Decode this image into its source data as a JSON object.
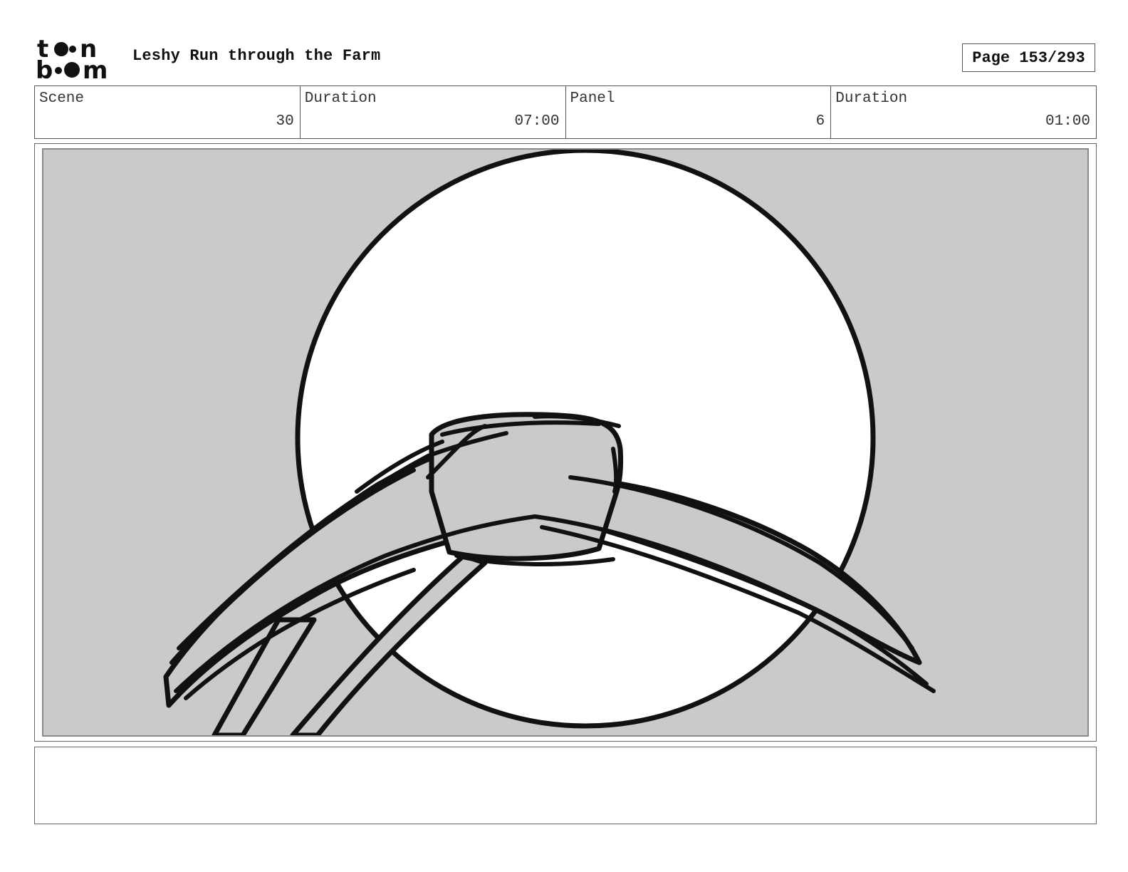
{
  "header": {
    "logo_text": "toon boom",
    "title": "Leshy Run through the Farm",
    "page_label": "Page 153/293"
  },
  "info": {
    "scene_label": "Scene",
    "scene_value": "30",
    "scene_duration_label": "Duration",
    "scene_duration_value": "07:00",
    "panel_label": "Panel",
    "panel_value": "6",
    "panel_duration_label": "Duration",
    "panel_duration_value": "01:00"
  },
  "notes": {
    "text": ""
  },
  "colors": {
    "panel_background": "#cacaca",
    "circle_fill": "#ffffff",
    "ink": "#111111"
  }
}
